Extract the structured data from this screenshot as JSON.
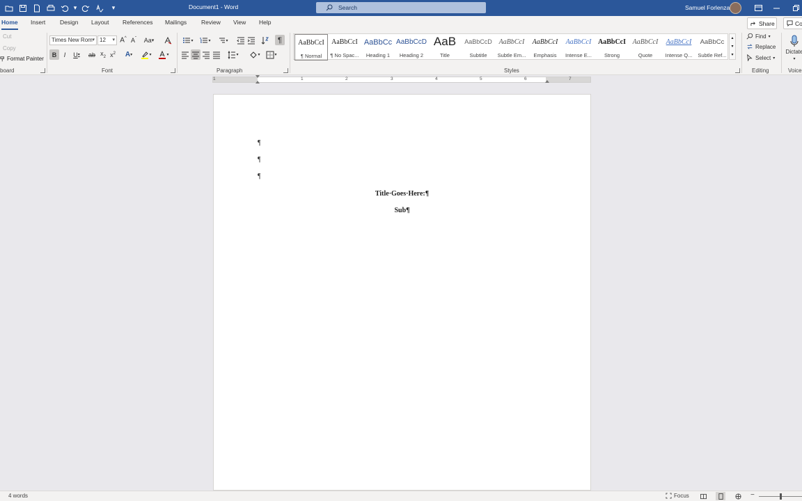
{
  "titlebar": {
    "doc_title": "Document1  -  Word",
    "search_placeholder": "Search",
    "user_name": "Samuel Forlenza"
  },
  "tabs": [
    {
      "label": "Home",
      "active": true
    },
    {
      "label": "Insert"
    },
    {
      "label": "Design"
    },
    {
      "label": "Layout"
    },
    {
      "label": "References"
    },
    {
      "label": "Mailings"
    },
    {
      "label": "Review"
    },
    {
      "label": "View"
    },
    {
      "label": "Help"
    }
  ],
  "share_label": "Share",
  "comments_label": "Con",
  "clipboard": {
    "cut": "Cut",
    "copy": "Copy",
    "format_painter": "Format Painter",
    "label": "board"
  },
  "font": {
    "name": "Times New Rom",
    "size": "12",
    "label": "Font",
    "change_case": "Aa"
  },
  "paragraph": {
    "label": "Paragraph"
  },
  "styles": {
    "label": "Styles",
    "items": [
      {
        "preview": "AaBbCcI",
        "name": "¶ Normal"
      },
      {
        "preview": "AaBbCcI",
        "name": "¶ No Spac..."
      },
      {
        "preview": "AaBbCc",
        "name": "Heading 1"
      },
      {
        "preview": "AaBbCcD",
        "name": "Heading 2"
      },
      {
        "preview": "AaB",
        "name": "Title"
      },
      {
        "preview": "AaBbCcD",
        "name": "Subtitle"
      },
      {
        "preview": "AaBbCcI",
        "name": "Subtle Em..."
      },
      {
        "preview": "AaBbCcI",
        "name": "Emphasis"
      },
      {
        "preview": "AaBbCcI",
        "name": "Intense E..."
      },
      {
        "preview": "AaBbCcI",
        "name": "Strong"
      },
      {
        "preview": "AaBbCcI",
        "name": "Quote"
      },
      {
        "preview": "AaBbCcI",
        "name": "Intense Q..."
      },
      {
        "preview": "AaBbCc",
        "name": "Subtle Ref..."
      }
    ]
  },
  "editing": {
    "find": "Find",
    "replace": "Replace",
    "select": "Select",
    "label": "Editing"
  },
  "voice": {
    "dictate": "Dictate",
    "label": "Voice"
  },
  "ruler": {
    "numbers": [
      "1",
      "1",
      "2",
      "3",
      "4",
      "5",
      "6",
      "7"
    ]
  },
  "document": {
    "pilcrow": "¶",
    "title_line": "Title·Goes·Here:¶",
    "sub_line": "Sub¶"
  },
  "statusbar": {
    "word_count": "4 words",
    "focus": "Focus"
  },
  "colors": {
    "brand": "#2b579a",
    "highlight": "#ffff00",
    "font_color": "#c00000"
  }
}
